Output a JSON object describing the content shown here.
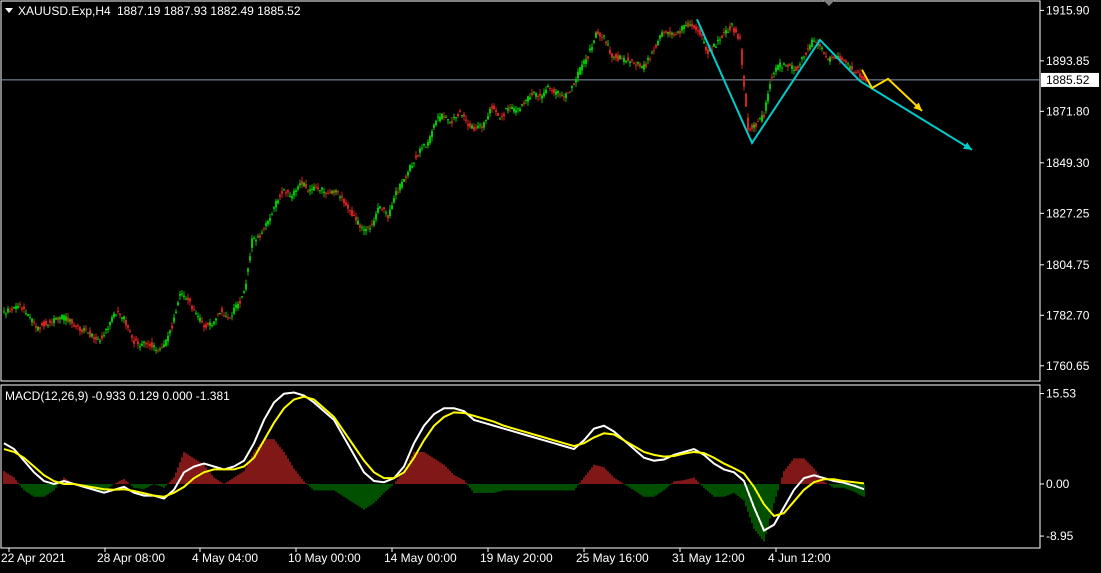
{
  "header": {
    "symbol": "XAUUSD.Exp,H4",
    "ohlc": "1887.19 1887.93 1882.49 1885.52"
  },
  "macd_header": {
    "label": "MACD(12,26,9) -0.933 0.129 0.000 -1.381"
  },
  "colors": {
    "background": "#000000",
    "bull_candle": "#00c800",
    "bear_candle": "#d42020",
    "frame": "#ffffff",
    "price_line": "#8a9ab0",
    "macd_line": "#ffffff",
    "signal_line": "#ffff00",
    "hist_pos": "#ff3030",
    "hist_neg": "#00a000",
    "drawing_cyan": "#00cccc",
    "drawing_yellow": "#ffd700"
  },
  "chart_data": [
    {
      "type": "candlestick",
      "title": "XAUUSD.Exp,H4",
      "x_tick_labels": [
        "22 Apr 2021",
        "28 Apr 08:00",
        "4 May 04:00",
        "10 May 00:00",
        "14 May 00:00",
        "19 May 20:00",
        "25 May 16:00",
        "31 May 12:00",
        "4 Jun 12:00"
      ],
      "y_tick_labels": [
        "1915.90",
        "1893.85",
        "1871.80",
        "1849.30",
        "1827.25",
        "1804.75",
        "1782.70",
        "1760.65"
      ],
      "ylim": [
        1754.0,
        1920.0
      ],
      "current_price": "1885.52",
      "close_path": [
        [
          0,
          1784
        ],
        [
          8,
          1785
        ],
        [
          16,
          1787
        ],
        [
          24,
          1783
        ],
        [
          32,
          1777
        ],
        [
          40,
          1779
        ],
        [
          48,
          1780
        ],
        [
          56,
          1782
        ],
        [
          64,
          1781
        ],
        [
          72,
          1778
        ],
        [
          80,
          1776
        ],
        [
          88,
          1774
        ],
        [
          96,
          1772
        ],
        [
          104,
          1778
        ],
        [
          112,
          1784
        ],
        [
          120,
          1781
        ],
        [
          128,
          1772
        ],
        [
          136,
          1770
        ],
        [
          144,
          1771
        ],
        [
          152,
          1768
        ],
        [
          160,
          1769
        ],
        [
          168,
          1778
        ],
        [
          176,
          1792
        ],
        [
          184,
          1790
        ],
        [
          192,
          1783
        ],
        [
          200,
          1778
        ],
        [
          208,
          1779
        ],
        [
          216,
          1785
        ],
        [
          224,
          1781
        ],
        [
          232,
          1786
        ],
        [
          240,
          1792
        ],
        [
          248,
          1815
        ],
        [
          256,
          1817
        ],
        [
          264,
          1824
        ],
        [
          272,
          1832
        ],
        [
          280,
          1838
        ],
        [
          288,
          1834
        ],
        [
          296,
          1841
        ],
        [
          304,
          1838
        ],
        [
          312,
          1838
        ],
        [
          320,
          1837
        ],
        [
          328,
          1837
        ],
        [
          336,
          1835
        ],
        [
          344,
          1830
        ],
        [
          352,
          1824
        ],
        [
          360,
          1820
        ],
        [
          368,
          1822
        ],
        [
          376,
          1831
        ],
        [
          384,
          1825
        ],
        [
          392,
          1836
        ],
        [
          400,
          1842
        ],
        [
          408,
          1849
        ],
        [
          416,
          1855
        ],
        [
          424,
          1858
        ],
        [
          432,
          1868
        ],
        [
          440,
          1870
        ],
        [
          448,
          1867
        ],
        [
          456,
          1872
        ],
        [
          464,
          1866
        ],
        [
          472,
          1864
        ],
        [
          480,
          1866
        ],
        [
          488,
          1874
        ],
        [
          496,
          1868
        ],
        [
          504,
          1874
        ],
        [
          512,
          1872
        ],
        [
          520,
          1875
        ],
        [
          528,
          1880
        ],
        [
          536,
          1878
        ],
        [
          544,
          1882
        ],
        [
          552,
          1880
        ],
        [
          560,
          1878
        ],
        [
          568,
          1882
        ],
        [
          576,
          1890
        ],
        [
          584,
          1896
        ],
        [
          592,
          1906
        ],
        [
          600,
          1904
        ],
        [
          608,
          1896
        ],
        [
          616,
          1895
        ],
        [
          624,
          1894
        ],
        [
          632,
          1893
        ],
        [
          640,
          1891
        ],
        [
          648,
          1897
        ],
        [
          656,
          1905
        ],
        [
          664,
          1906
        ],
        [
          672,
          1905
        ],
        [
          680,
          1909
        ],
        [
          688,
          1910
        ],
        [
          696,
          1906
        ],
        [
          704,
          1897
        ],
        [
          712,
          1901
        ],
        [
          720,
          1906
        ],
        [
          728,
          1909
        ],
        [
          736,
          1903
        ],
        [
          744,
          1864
        ],
        [
          752,
          1866
        ],
        [
          760,
          1870
        ],
        [
          768,
          1888
        ],
        [
          776,
          1892
        ],
        [
          784,
          1892
        ],
        [
          792,
          1890
        ],
        [
          800,
          1896
        ],
        [
          808,
          1902
        ],
        [
          816,
          1901
        ],
        [
          824,
          1894
        ],
        [
          832,
          1896
        ],
        [
          840,
          1893
        ],
        [
          848,
          1890
        ],
        [
          856,
          1887
        ],
        [
          862,
          1885.5
        ]
      ],
      "drawings": {
        "cyan_zigzag": [
          [
            "31 May 20:00",
            1912
          ],
          [
            "3 Jun 04:00",
            1858
          ],
          [
            "7 Jun 04:00",
            1903
          ],
          [
            "9 Jun 04:00",
            1885
          ],
          [
            "14 Jun 00:00",
            1855
          ]
        ],
        "yellow_projection": [
          [
            "8 Jun 08:00",
            1890
          ],
          [
            "8 Jun 16:00",
            1882
          ],
          [
            "9 Jun 00:00",
            1886
          ],
          [
            "9 Jun 12:00",
            1872
          ]
        ]
      }
    },
    {
      "type": "macd",
      "title": "MACD(12,26,9) -0.933 0.129 0.000 -1.381",
      "y_tick_labels": [
        "15.53",
        "0.00",
        "-8.95"
      ],
      "ylim": [
        -11.0,
        17.0
      ],
      "macd_line": [
        [
          0,
          7
        ],
        [
          10,
          6
        ],
        [
          20,
          4
        ],
        [
          30,
          2
        ],
        [
          40,
          0.5
        ],
        [
          50,
          0
        ],
        [
          60,
          0.5
        ],
        [
          70,
          0
        ],
        [
          80,
          -0.5
        ],
        [
          90,
          -1
        ],
        [
          100,
          -1.5
        ],
        [
          110,
          -1
        ],
        [
          120,
          -0.5
        ],
        [
          130,
          -1.5
        ],
        [
          140,
          -2
        ],
        [
          150,
          -2
        ],
        [
          160,
          -2.5
        ],
        [
          170,
          -1
        ],
        [
          180,
          2
        ],
        [
          190,
          3
        ],
        [
          200,
          3.5
        ],
        [
          210,
          3
        ],
        [
          220,
          2.5
        ],
        [
          230,
          3
        ],
        [
          240,
          4
        ],
        [
          250,
          7
        ],
        [
          260,
          11
        ],
        [
          270,
          14
        ],
        [
          280,
          15.5
        ],
        [
          290,
          15.7
        ],
        [
          300,
          15.2
        ],
        [
          310,
          14
        ],
        [
          320,
          12.5
        ],
        [
          330,
          11
        ],
        [
          340,
          8
        ],
        [
          350,
          5
        ],
        [
          360,
          2
        ],
        [
          370,
          0.5
        ],
        [
          380,
          0.3
        ],
        [
          390,
          1
        ],
        [
          400,
          3
        ],
        [
          410,
          7
        ],
        [
          420,
          10
        ],
        [
          430,
          12
        ],
        [
          440,
          13
        ],
        [
          450,
          13
        ],
        [
          460,
          12.5
        ],
        [
          470,
          11
        ],
        [
          480,
          10.5
        ],
        [
          490,
          10
        ],
        [
          500,
          9.5
        ],
        [
          510,
          9
        ],
        [
          520,
          8.5
        ],
        [
          530,
          8
        ],
        [
          540,
          7.5
        ],
        [
          550,
          7
        ],
        [
          560,
          6.5
        ],
        [
          570,
          6
        ],
        [
          580,
          7.5
        ],
        [
          590,
          9.5
        ],
        [
          600,
          10
        ],
        [
          610,
          9
        ],
        [
          620,
          7.5
        ],
        [
          630,
          6
        ],
        [
          640,
          4.5
        ],
        [
          650,
          4
        ],
        [
          660,
          4.2
        ],
        [
          670,
          5
        ],
        [
          680,
          5.5
        ],
        [
          690,
          6
        ],
        [
          700,
          5
        ],
        [
          710,
          3.5
        ],
        [
          720,
          2.5
        ],
        [
          730,
          2
        ],
        [
          740,
          0.5
        ],
        [
          750,
          -4
        ],
        [
          760,
          -8
        ],
        [
          770,
          -7
        ],
        [
          780,
          -4
        ],
        [
          790,
          -1
        ],
        [
          800,
          1
        ],
        [
          810,
          1.5
        ],
        [
          820,
          1
        ],
        [
          830,
          0.5
        ],
        [
          840,
          0.2
        ],
        [
          850,
          -0.3
        ],
        [
          860,
          -0.9
        ]
      ],
      "signal_line": [
        [
          0,
          6
        ],
        [
          10,
          5.5
        ],
        [
          20,
          4.5
        ],
        [
          30,
          3
        ],
        [
          40,
          1.5
        ],
        [
          50,
          0.5
        ],
        [
          60,
          0
        ],
        [
          70,
          0
        ],
        [
          80,
          -0.3
        ],
        [
          90,
          -0.6
        ],
        [
          100,
          -0.9
        ],
        [
          110,
          -1
        ],
        [
          120,
          -0.9
        ],
        [
          130,
          -1.2
        ],
        [
          140,
          -1.6
        ],
        [
          150,
          -2
        ],
        [
          160,
          -2.2
        ],
        [
          170,
          -1.5
        ],
        [
          180,
          -0.5
        ],
        [
          190,
          1
        ],
        [
          200,
          2
        ],
        [
          210,
          2.5
        ],
        [
          220,
          2.5
        ],
        [
          230,
          2.5
        ],
        [
          240,
          3
        ],
        [
          250,
          4.5
        ],
        [
          260,
          7.5
        ],
        [
          270,
          10.5
        ],
        [
          280,
          13
        ],
        [
          290,
          14.5
        ],
        [
          300,
          15
        ],
        [
          310,
          14.5
        ],
        [
          320,
          13
        ],
        [
          330,
          11.5
        ],
        [
          340,
          9
        ],
        [
          350,
          6.5
        ],
        [
          360,
          4
        ],
        [
          370,
          2
        ],
        [
          380,
          1
        ],
        [
          390,
          1
        ],
        [
          400,
          2
        ],
        [
          410,
          4.5
        ],
        [
          420,
          7.5
        ],
        [
          430,
          10
        ],
        [
          440,
          11.5
        ],
        [
          450,
          12.3
        ],
        [
          460,
          12.2
        ],
        [
          470,
          11.7
        ],
        [
          480,
          11.2
        ],
        [
          490,
          10.7
        ],
        [
          500,
          10
        ],
        [
          510,
          9.5
        ],
        [
          520,
          9
        ],
        [
          530,
          8.5
        ],
        [
          540,
          8
        ],
        [
          550,
          7.5
        ],
        [
          560,
          7
        ],
        [
          570,
          6.5
        ],
        [
          580,
          7
        ],
        [
          590,
          8
        ],
        [
          600,
          8.7
        ],
        [
          610,
          8.5
        ],
        [
          620,
          7.5
        ],
        [
          630,
          6.5
        ],
        [
          640,
          5.5
        ],
        [
          650,
          5
        ],
        [
          660,
          4.7
        ],
        [
          670,
          4.8
        ],
        [
          680,
          5.2
        ],
        [
          690,
          5.5
        ],
        [
          700,
          5.3
        ],
        [
          710,
          4.5
        ],
        [
          720,
          3.5
        ],
        [
          730,
          2.7
        ],
        [
          740,
          1.8
        ],
        [
          750,
          -0.5
        ],
        [
          760,
          -3.5
        ],
        [
          770,
          -5.5
        ],
        [
          780,
          -5
        ],
        [
          790,
          -3
        ],
        [
          800,
          -1
        ],
        [
          810,
          0.3
        ],
        [
          820,
          0.8
        ],
        [
          830,
          0.8
        ],
        [
          840,
          0.5
        ],
        [
          850,
          0.3
        ],
        [
          860,
          0.1
        ]
      ]
    }
  ]
}
